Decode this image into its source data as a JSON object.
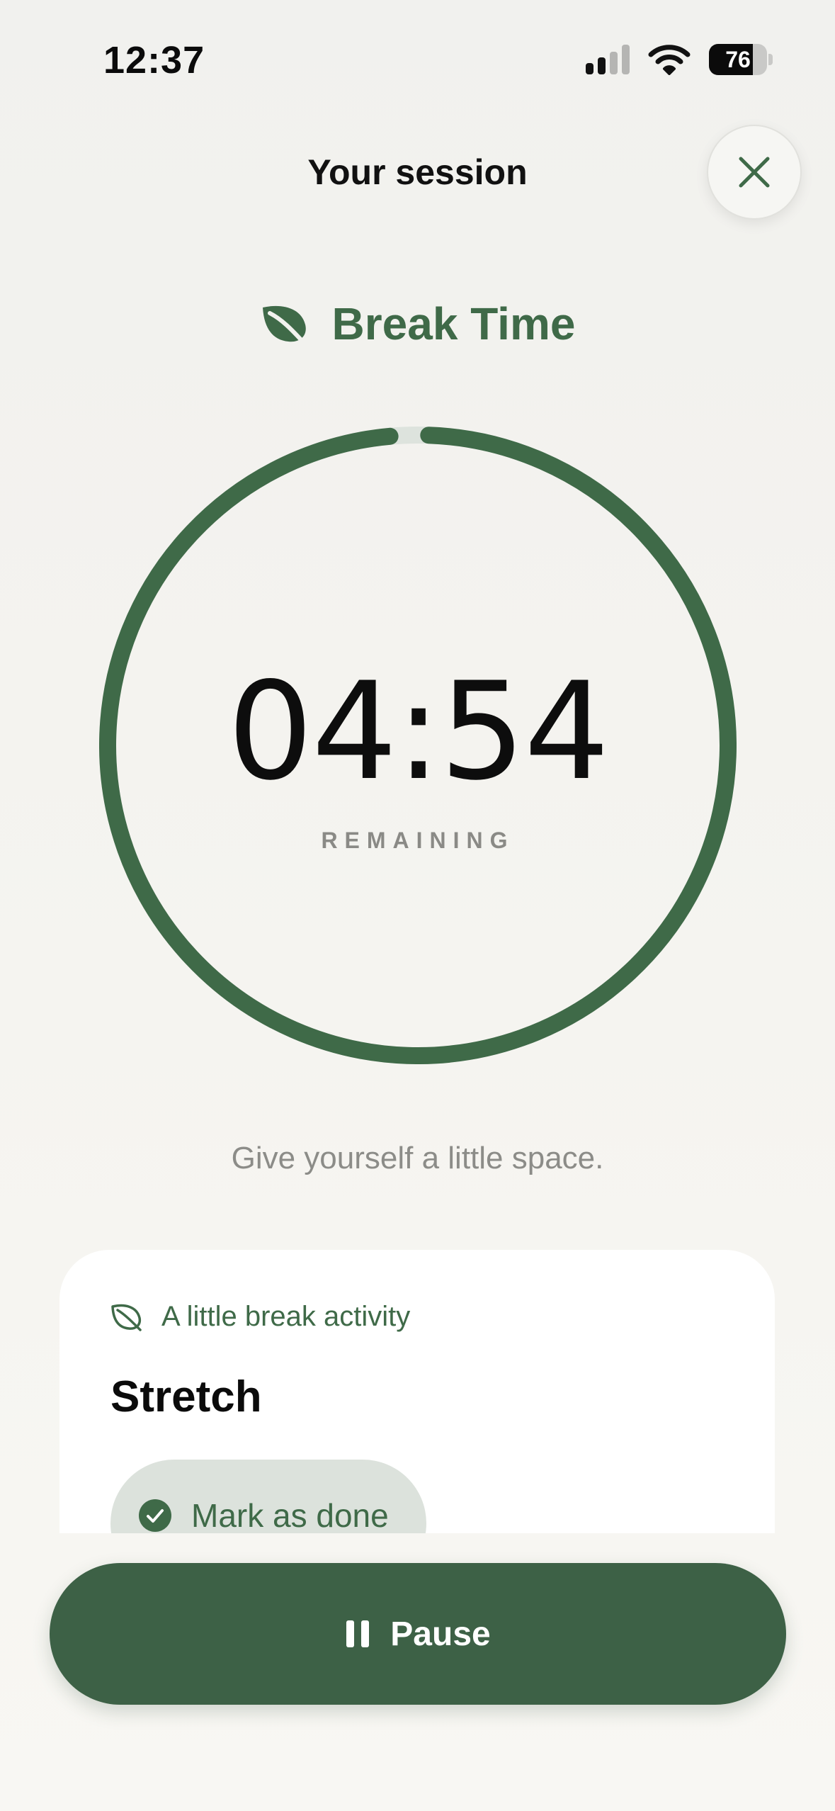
{
  "status_bar": {
    "time": "12:37",
    "battery_level": "76",
    "battery_fraction": 0.76,
    "signal_bars_active": 2,
    "signal_bars_total": 4
  },
  "header": {
    "title": "Your session",
    "close_icon": "close-icon"
  },
  "mode": {
    "icon": "leaf-icon",
    "label": "Break Time"
  },
  "timer": {
    "value": "04:54",
    "caption": "REMAINING",
    "progress_fraction": 0.98
  },
  "tagline": "Give yourself a little space.",
  "activity": {
    "icon": "leaf-outline-icon",
    "header": "A little break activity",
    "title": "Stretch",
    "done_label": "Mark as done",
    "done_icon": "check-circle-icon"
  },
  "pause": {
    "icon": "pause-icon",
    "label": "Pause"
  },
  "colors": {
    "accent": "#3f6a48",
    "button": "#3d6146",
    "ring_track": "#dde3dd",
    "background": "#f3f2ee"
  }
}
